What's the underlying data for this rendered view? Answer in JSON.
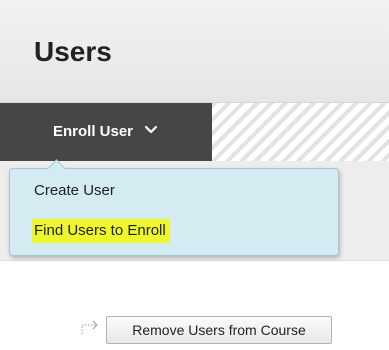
{
  "header": {
    "title": "Users"
  },
  "action_bar": {
    "enroll_label": "Enroll User"
  },
  "dropdown": {
    "items": [
      {
        "label": "Create User",
        "highlighted": false
      },
      {
        "label": "Find Users to Enroll",
        "highlighted": true
      }
    ],
    "background": "#d4ebf1",
    "highlight_color": "#eef72c"
  },
  "actions": {
    "remove_label": "Remove Users from Course"
  },
  "icons": {
    "enroll_chevron": "chevron-down-icon",
    "remove_arrow": "dotted-arrow-icon"
  }
}
